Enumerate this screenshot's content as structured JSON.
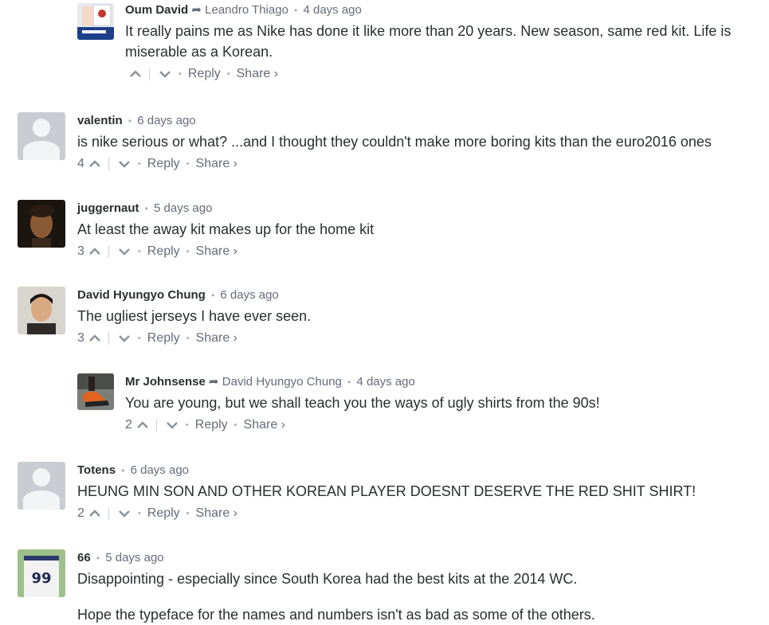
{
  "comments": [
    {
      "id": "c1",
      "author": "Oum David",
      "reply_to": "Leandro Thiago",
      "time": "4 days ago",
      "text": [
        "It really pains me as Nike has done it like more than 20 years. New season, same red kit. Life is miserable as a Korean."
      ],
      "votes": "",
      "avatar": "photo-flag"
    },
    {
      "id": "c2",
      "author": "valentin",
      "reply_to": "",
      "time": "6 days ago",
      "text": [
        "is nike serious or what? ...and I thought they couldn't make more boring kits than the euro2016 ones"
      ],
      "votes": "4",
      "avatar": "default"
    },
    {
      "id": "c3",
      "author": "juggernaut",
      "reply_to": "",
      "time": "5 days ago",
      "text": [
        "At least the away kit makes up for the home kit"
      ],
      "votes": "3",
      "avatar": "photo-face-dark"
    },
    {
      "id": "c4",
      "author": "David Hyungyo Chung",
      "reply_to": "",
      "time": "6 days ago",
      "text": [
        "The ugliest jerseys I have ever seen."
      ],
      "votes": "3",
      "avatar": "photo-face"
    },
    {
      "id": "c5",
      "author": "Mr Johnsense",
      "reply_to": "David Hyungyo Chung",
      "time": "4 days ago",
      "text": [
        "You are young, but we shall teach you the ways of ugly shirts from the 90s!"
      ],
      "votes": "2",
      "avatar": "photo-shoes"
    },
    {
      "id": "c6",
      "author": "Totens",
      "reply_to": "",
      "time": "6 days ago",
      "text": [
        "HEUNG MIN SON AND OTHER KOREAN PLAYER DOESNT DESERVE THE RED SHIT SHIRT!"
      ],
      "votes": "2",
      "avatar": "default"
    },
    {
      "id": "c7",
      "author": "66",
      "reply_to": "",
      "time": "5 days ago",
      "text": [
        "Disappointing - especially since South Korea had the best kits at the 2014 WC.",
        "Hope the typeface for the names and numbers isn't as bad as some of the others."
      ],
      "votes": "",
      "avatar": "photo-jersey-99"
    }
  ],
  "actions": {
    "reply": "Reply",
    "share": "Share ›"
  },
  "colors": {
    "text": "#2a2e2e",
    "meta": "#656c7a",
    "separator": "#a8adb3"
  }
}
